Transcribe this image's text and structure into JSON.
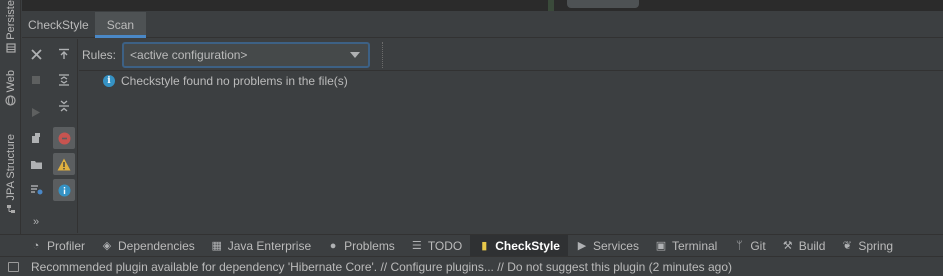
{
  "left_stripe": {
    "tabs": [
      {
        "label": "Persiste",
        "icon": "database-icon"
      },
      {
        "label": "Web",
        "icon": "globe-icon"
      },
      {
        "label": "JPA Structure",
        "icon": "structure-icon"
      }
    ]
  },
  "tool_window": {
    "title": "CheckStyle",
    "tabs": [
      {
        "label": "Scan",
        "active": true
      }
    ]
  },
  "rules": {
    "label": "Rules:",
    "selected": "<active configuration>"
  },
  "result": {
    "message": "Checkstyle found no problems in the file(s)",
    "icon": "info-icon"
  },
  "toolbar": {
    "more_label": "»"
  },
  "bottom_tabs": [
    {
      "label": "Profiler",
      "icon": "profiler-icon",
      "active": false
    },
    {
      "label": "Dependencies",
      "icon": "dependencies-icon",
      "active": false
    },
    {
      "label": "Java Enterprise",
      "icon": "java-enterprise-icon",
      "active": false
    },
    {
      "label": "Problems",
      "icon": "problems-icon",
      "active": false
    },
    {
      "label": "TODO",
      "icon": "todo-icon",
      "active": false
    },
    {
      "label": "CheckStyle",
      "icon": "checkstyle-icon",
      "active": true
    },
    {
      "label": "Services",
      "icon": "services-icon",
      "active": false
    },
    {
      "label": "Terminal",
      "icon": "terminal-icon",
      "active": false
    },
    {
      "label": "Git",
      "icon": "git-icon",
      "active": false
    },
    {
      "label": "Build",
      "icon": "build-icon",
      "active": false
    },
    {
      "label": "Spring",
      "icon": "spring-icon",
      "active": false
    }
  ],
  "status_bar": {
    "message": "Recommended plugin available for dependency 'Hibernate Core'. // Configure plugins... // Do not suggest this plugin (2 minutes ago)"
  },
  "colors": {
    "background": "#3c3f41",
    "accent": "#4a88c7",
    "error": "#c75450",
    "warning": "#e0b040",
    "info": "#3592c4"
  }
}
